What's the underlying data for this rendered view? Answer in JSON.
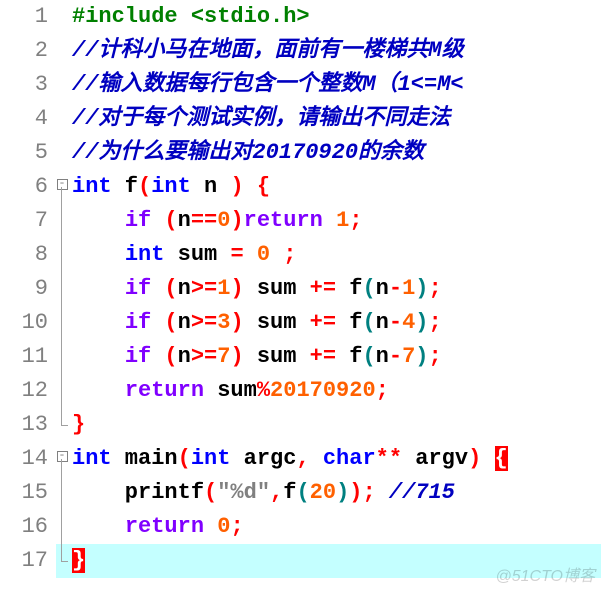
{
  "watermark": "@51CTO博客",
  "lines": {
    "l1": {
      "num": "1",
      "fold": "",
      "tokens": [
        [
          "preproc",
          "#include <stdio.h>"
        ]
      ]
    },
    "l2": {
      "num": "2",
      "fold": "",
      "tokens": [
        [
          "comment",
          "//计科小马在地面，面前有一楼梯共M级"
        ]
      ]
    },
    "l3": {
      "num": "3",
      "fold": "",
      "tokens": [
        [
          "comment",
          "//输入数据每行包含一个整数M（1<=M<"
        ]
      ]
    },
    "l4": {
      "num": "4",
      "fold": "",
      "tokens": [
        [
          "comment",
          "//对于每个测试实例，请输出不同走法"
        ]
      ]
    },
    "l5": {
      "num": "5",
      "fold": "",
      "tokens": [
        [
          "comment",
          "//为什么要输出对20170920的余数"
        ]
      ]
    },
    "l6": {
      "num": "6",
      "fold": "start",
      "tokens": [
        [
          "type",
          "int"
        ],
        [
          "iden",
          " f"
        ],
        [
          "paren",
          "("
        ],
        [
          "type",
          "int"
        ],
        [
          "iden",
          " n "
        ],
        [
          "paren",
          ")"
        ],
        [
          "iden",
          " "
        ],
        [
          "op",
          "{"
        ]
      ]
    },
    "l7": {
      "num": "7",
      "fold": "mid",
      "tokens": [
        [
          "iden",
          "    "
        ],
        [
          "kw",
          "if"
        ],
        [
          "iden",
          " "
        ],
        [
          "paren",
          "("
        ],
        [
          "iden",
          "n"
        ],
        [
          "op",
          "=="
        ],
        [
          "num",
          "0"
        ],
        [
          "paren",
          ")"
        ],
        [
          "kw",
          "return"
        ],
        [
          "iden",
          " "
        ],
        [
          "num",
          "1"
        ],
        [
          "op",
          ";"
        ]
      ]
    },
    "l8": {
      "num": "8",
      "fold": "mid",
      "tokens": [
        [
          "iden",
          "    "
        ],
        [
          "type",
          "int"
        ],
        [
          "iden",
          " sum "
        ],
        [
          "op",
          "="
        ],
        [
          "iden",
          " "
        ],
        [
          "num",
          "0"
        ],
        [
          "iden",
          " "
        ],
        [
          "op",
          ";"
        ]
      ]
    },
    "l9": {
      "num": "9",
      "fold": "mid",
      "tokens": [
        [
          "iden",
          "    "
        ],
        [
          "kw",
          "if"
        ],
        [
          "iden",
          " "
        ],
        [
          "paren",
          "("
        ],
        [
          "iden",
          "n"
        ],
        [
          "op",
          ">="
        ],
        [
          "num",
          "1"
        ],
        [
          "paren",
          ")"
        ],
        [
          "iden",
          " sum "
        ],
        [
          "op",
          "+="
        ],
        [
          "iden",
          " f"
        ],
        [
          "paren-b",
          "("
        ],
        [
          "iden",
          "n"
        ],
        [
          "op",
          "-"
        ],
        [
          "num",
          "1"
        ],
        [
          "paren-b",
          ")"
        ],
        [
          "op",
          ";"
        ]
      ]
    },
    "l10": {
      "num": "10",
      "fold": "mid",
      "tokens": [
        [
          "iden",
          "    "
        ],
        [
          "kw",
          "if"
        ],
        [
          "iden",
          " "
        ],
        [
          "paren",
          "("
        ],
        [
          "iden",
          "n"
        ],
        [
          "op",
          ">="
        ],
        [
          "num",
          "3"
        ],
        [
          "paren",
          ")"
        ],
        [
          "iden",
          " sum "
        ],
        [
          "op",
          "+="
        ],
        [
          "iden",
          " f"
        ],
        [
          "paren-b",
          "("
        ],
        [
          "iden",
          "n"
        ],
        [
          "op",
          "-"
        ],
        [
          "num",
          "4"
        ],
        [
          "paren-b",
          ")"
        ],
        [
          "op",
          ";"
        ]
      ]
    },
    "l11": {
      "num": "11",
      "fold": "mid",
      "tokens": [
        [
          "iden",
          "    "
        ],
        [
          "kw",
          "if"
        ],
        [
          "iden",
          " "
        ],
        [
          "paren",
          "("
        ],
        [
          "iden",
          "n"
        ],
        [
          "op",
          ">="
        ],
        [
          "num",
          "7"
        ],
        [
          "paren",
          ")"
        ],
        [
          "iden",
          " sum "
        ],
        [
          "op",
          "+="
        ],
        [
          "iden",
          " f"
        ],
        [
          "paren-b",
          "("
        ],
        [
          "iden",
          "n"
        ],
        [
          "op",
          "-"
        ],
        [
          "num",
          "7"
        ],
        [
          "paren-b",
          ")"
        ],
        [
          "op",
          ";"
        ]
      ]
    },
    "l12": {
      "num": "12",
      "fold": "mid",
      "tokens": [
        [
          "iden",
          "    "
        ],
        [
          "kw",
          "return"
        ],
        [
          "iden",
          " sum"
        ],
        [
          "op",
          "%"
        ],
        [
          "num",
          "20170920"
        ],
        [
          "op",
          ";"
        ]
      ]
    },
    "l13": {
      "num": "13",
      "fold": "end",
      "tokens": [
        [
          "op",
          "}"
        ]
      ]
    },
    "l14": {
      "num": "14",
      "fold": "start",
      "tokens": [
        [
          "type",
          "int"
        ],
        [
          "iden",
          " main"
        ],
        [
          "paren",
          "("
        ],
        [
          "type",
          "int"
        ],
        [
          "iden",
          " argc"
        ],
        [
          "op",
          ","
        ],
        [
          "iden",
          " "
        ],
        [
          "type",
          "char"
        ],
        [
          "op",
          "**"
        ],
        [
          "iden",
          " argv"
        ],
        [
          "paren",
          ")"
        ],
        [
          "iden",
          " "
        ],
        [
          "warn",
          "{"
        ]
      ]
    },
    "l15": {
      "num": "15",
      "fold": "mid",
      "tokens": [
        [
          "iden",
          "    printf"
        ],
        [
          "paren",
          "("
        ],
        [
          "str",
          "\"%d\""
        ],
        [
          "op",
          ","
        ],
        [
          "iden",
          "f"
        ],
        [
          "paren-b",
          "("
        ],
        [
          "num",
          "20"
        ],
        [
          "paren-b",
          ")"
        ],
        [
          "paren",
          ")"
        ],
        [
          "op",
          ";"
        ],
        [
          "iden",
          " "
        ],
        [
          "comment",
          "//715"
        ]
      ]
    },
    "l16": {
      "num": "16",
      "fold": "mid",
      "tokens": [
        [
          "iden",
          "    "
        ],
        [
          "kw",
          "return"
        ],
        [
          "iden",
          " "
        ],
        [
          "num",
          "0"
        ],
        [
          "op",
          ";"
        ]
      ]
    },
    "l17": {
      "num": "17",
      "fold": "end",
      "hl": true,
      "tokens": [
        [
          "warn",
          "}"
        ]
      ]
    }
  },
  "order": [
    "l1",
    "l2",
    "l3",
    "l4",
    "l5",
    "l6",
    "l7",
    "l8",
    "l9",
    "l10",
    "l11",
    "l12",
    "l13",
    "l14",
    "l15",
    "l16",
    "l17"
  ]
}
